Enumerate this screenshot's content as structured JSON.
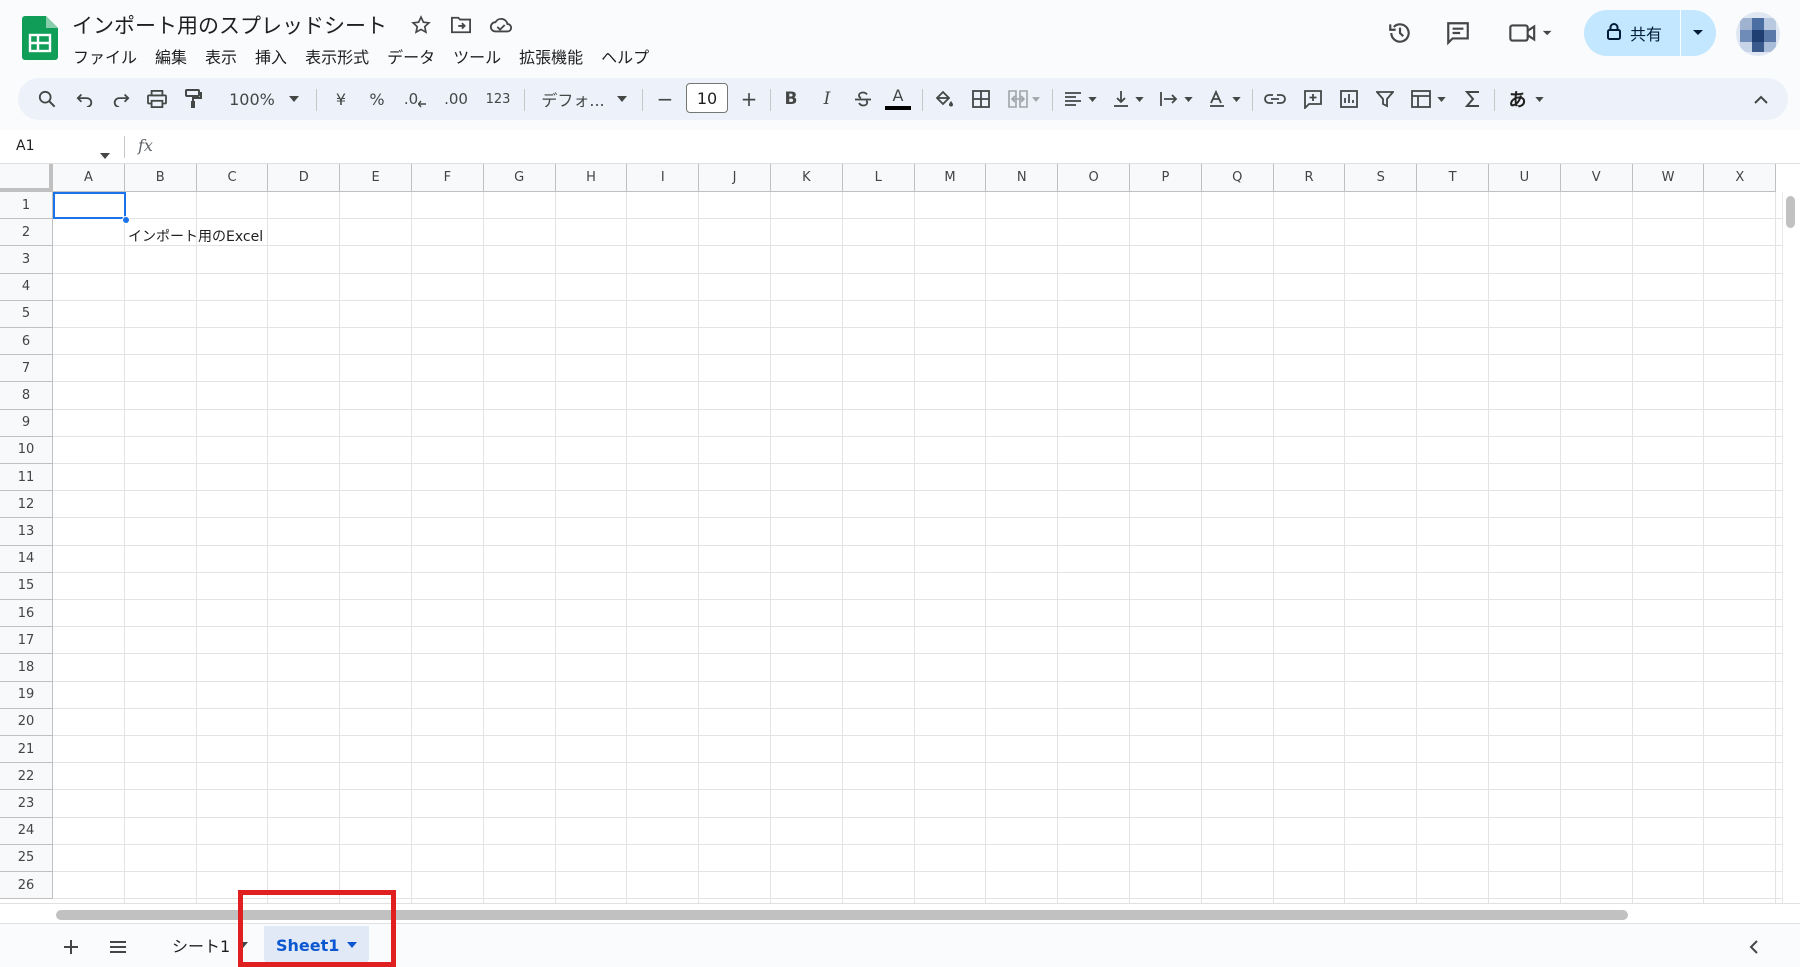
{
  "app": {
    "doc_title": "インポート用のスプレッドシート",
    "menu": [
      "ファイル",
      "編集",
      "表示",
      "挿入",
      "表示形式",
      "データ",
      "ツール",
      "拡張機能",
      "ヘルプ"
    ],
    "share_label": "共有"
  },
  "toolbar": {
    "zoom": "100%",
    "currency": "¥",
    "percent": "%",
    "decrease_decimal": ".0",
    "increase_decimal": ".00",
    "number_format": "123",
    "font": "デフォ...",
    "font_size": "10",
    "minus": "−",
    "plus": "+",
    "bold": "B",
    "italic": "I",
    "text_color_letter": "A",
    "input_tool": "あ"
  },
  "formula_bar": {
    "name_box": "A1",
    "fx": "fx"
  },
  "grid": {
    "columns": [
      "A",
      "B",
      "C",
      "D",
      "E",
      "F",
      "G",
      "H",
      "I",
      "J",
      "K",
      "L",
      "M",
      "N",
      "O",
      "P",
      "Q",
      "R",
      "S",
      "T",
      "U",
      "V",
      "W",
      "X"
    ],
    "rows": [
      "1",
      "2",
      "3",
      "4",
      "5",
      "6",
      "7",
      "8",
      "9",
      "10",
      "11",
      "12",
      "13",
      "14",
      "15",
      "16",
      "17",
      "18",
      "19",
      "20",
      "21",
      "22",
      "23",
      "24",
      "25",
      "26"
    ],
    "cell_b2": "インポート用のExcel"
  },
  "sheets": {
    "tabs": [
      "シート1",
      "Sheet1"
    ],
    "active": "Sheet1"
  },
  "colors": {
    "accent": "#1a73e8",
    "share_bg": "#c2e7ff",
    "active_tab_text": "#0b57d0",
    "highlight": "#e02020",
    "sheets_green": "#0f9d58"
  }
}
